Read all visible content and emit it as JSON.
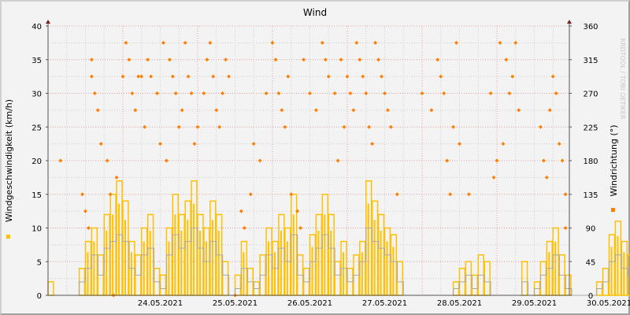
{
  "chart_data": {
    "type": "line",
    "title": "Wind",
    "ylabel": "Windgeschwindigkeit (km/h)",
    "y2label": "Windrichtung (°)",
    "watermark": "RRDTOOL / TOBI OETIKER",
    "ylim": [
      0,
      40
    ],
    "y2lim": [
      0,
      360
    ],
    "yticks": [
      "0",
      "5",
      "10",
      "15",
      "20",
      "25",
      "30",
      "35",
      "40"
    ],
    "y2ticks": [
      "0",
      "45",
      "90",
      "135",
      "180",
      "225",
      "270",
      "315",
      "360"
    ],
    "xtick_labels": [
      "24.05.2021",
      "25.05.2021",
      "26.05.2021",
      "27.05.2021",
      "28.05.2021",
      "29.05.2021",
      "30.05.2021"
    ],
    "x_range_hours": [
      0,
      167
    ],
    "sample_interval_hours": 2,
    "grid": true,
    "colors": {
      "gust": "#ffc000",
      "avg": "#a8a8a8",
      "direction": "#ff8000",
      "axis": "#7a2020",
      "grid_major": "#e0a0a0",
      "grid_minor": "#d0d0d0"
    },
    "series": [
      {
        "name": "gust",
        "values": [
          2,
          0,
          0,
          0,
          0,
          4,
          8,
          10,
          6,
          12,
          15,
          17,
          14,
          8,
          6,
          10,
          12,
          4,
          3,
          10,
          15,
          12,
          14,
          17,
          12,
          10,
          14,
          12,
          5,
          0,
          3,
          8,
          4,
          2,
          6,
          10,
          8,
          12,
          10,
          15,
          6,
          4,
          9,
          12,
          15,
          12,
          5,
          8,
          4,
          6,
          8,
          17,
          14,
          12,
          10,
          9,
          5,
          0,
          0,
          0,
          0,
          0,
          0,
          0,
          0,
          2,
          4,
          5,
          3,
          6,
          5,
          0,
          0,
          0,
          0,
          0,
          5,
          0,
          2,
          5,
          8,
          10,
          6,
          3,
          0,
          0,
          0,
          0,
          2,
          4,
          9,
          11,
          8,
          6,
          4,
          2
        ]
      },
      {
        "name": "avg",
        "values": [
          0,
          0,
          0,
          0,
          0,
          2,
          4,
          6,
          3,
          7,
          8,
          9,
          8,
          4,
          3,
          6,
          7,
          2,
          1,
          6,
          9,
          7,
          8,
          10,
          7,
          5,
          8,
          6,
          3,
          0,
          1,
          4,
          2,
          1,
          3,
          6,
          4,
          7,
          5,
          9,
          3,
          2,
          5,
          7,
          9,
          7,
          3,
          4,
          2,
          3,
          5,
          10,
          8,
          7,
          6,
          5,
          2,
          0,
          0,
          0,
          0,
          0,
          0,
          0,
          0,
          1,
          2,
          3,
          1,
          3,
          2,
          0,
          0,
          0,
          0,
          0,
          2,
          0,
          1,
          3,
          4,
          6,
          3,
          1,
          0,
          0,
          0,
          0,
          1,
          2,
          5,
          6,
          4,
          3,
          2,
          1
        ]
      },
      {
        "name": "direction",
        "points": [
          [
            4,
            180
          ],
          [
            11,
            135
          ],
          [
            12,
            112.5
          ],
          [
            13,
            90
          ],
          [
            14,
            315
          ],
          [
            14,
            292.5
          ],
          [
            15,
            270
          ],
          [
            16,
            247.5
          ],
          [
            17,
            202.5
          ],
          [
            19,
            180
          ],
          [
            20,
            135
          ],
          [
            21,
            0
          ],
          [
            22,
            157.5
          ],
          [
            24,
            292.5
          ],
          [
            25,
            337.5
          ],
          [
            26,
            315
          ],
          [
            27,
            270
          ],
          [
            28,
            247.5
          ],
          [
            29,
            292.5
          ],
          [
            30,
            292.5
          ],
          [
            31,
            225
          ],
          [
            32,
            315
          ],
          [
            33,
            292.5
          ],
          [
            35,
            270
          ],
          [
            36,
            202.5
          ],
          [
            37,
            337.5
          ],
          [
            38,
            180
          ],
          [
            39,
            315
          ],
          [
            40,
            292.5
          ],
          [
            41,
            270
          ],
          [
            42,
            225
          ],
          [
            43,
            247.5
          ],
          [
            44,
            337.5
          ],
          [
            45,
            292.5
          ],
          [
            46,
            270
          ],
          [
            47,
            202.5
          ],
          [
            48,
            225
          ],
          [
            50,
            270
          ],
          [
            51,
            315
          ],
          [
            52,
            337.5
          ],
          [
            53,
            292.5
          ],
          [
            54,
            247.5
          ],
          [
            55,
            225
          ],
          [
            56,
            270
          ],
          [
            57,
            315
          ],
          [
            58,
            292.5
          ],
          [
            60,
            0
          ],
          [
            62,
            112.5
          ],
          [
            63,
            90
          ],
          [
            65,
            135
          ],
          [
            66,
            202.5
          ],
          [
            68,
            180
          ],
          [
            70,
            270
          ],
          [
            72,
            337.5
          ],
          [
            73,
            315
          ],
          [
            74,
            270
          ],
          [
            75,
            247.5
          ],
          [
            76,
            225
          ],
          [
            77,
            292.5
          ],
          [
            78,
            135
          ],
          [
            80,
            112.5
          ],
          [
            81,
            90
          ],
          [
            82,
            315
          ],
          [
            84,
            270
          ],
          [
            86,
            247.5
          ],
          [
            88,
            337.5
          ],
          [
            89,
            315
          ],
          [
            90,
            292.5
          ],
          [
            92,
            270
          ],
          [
            93,
            180
          ],
          [
            94,
            315
          ],
          [
            95,
            225
          ],
          [
            96,
            292.5
          ],
          [
            97,
            270
          ],
          [
            98,
            247.5
          ],
          [
            99,
            337.5
          ],
          [
            100,
            315
          ],
          [
            101,
            292.5
          ],
          [
            102,
            270
          ],
          [
            103,
            225
          ],
          [
            104,
            202.5
          ],
          [
            105,
            337.5
          ],
          [
            106,
            315
          ],
          [
            107,
            292.5
          ],
          [
            108,
            270
          ],
          [
            109,
            247.5
          ],
          [
            110,
            225
          ],
          [
            112,
            135
          ],
          [
            120,
            270
          ],
          [
            123,
            247.5
          ],
          [
            125,
            315
          ],
          [
            126,
            292.5
          ],
          [
            127,
            270
          ],
          [
            128,
            180
          ],
          [
            129,
            135
          ],
          [
            130,
            225
          ],
          [
            131,
            337.5
          ],
          [
            132,
            202.5
          ],
          [
            135,
            135
          ],
          [
            142,
            270
          ],
          [
            143,
            157.5
          ],
          [
            144,
            180
          ],
          [
            145,
            337.5
          ],
          [
            146,
            202.5
          ],
          [
            147,
            315
          ],
          [
            148,
            270
          ],
          [
            149,
            292.5
          ],
          [
            150,
            337.5
          ],
          [
            151,
            247.5
          ],
          [
            158,
            225
          ],
          [
            159,
            180
          ],
          [
            160,
            157.5
          ],
          [
            161,
            247.5
          ],
          [
            162,
            292.5
          ],
          [
            163,
            270
          ],
          [
            164,
            202.5
          ],
          [
            165,
            180
          ],
          [
            166,
            90
          ],
          [
            166,
            135
          ]
        ]
      }
    ]
  }
}
